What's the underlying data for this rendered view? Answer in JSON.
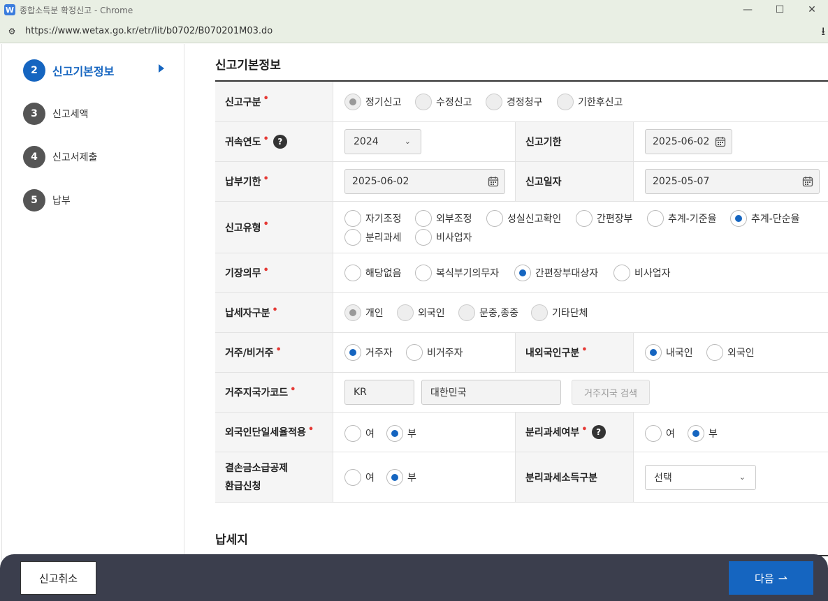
{
  "browser": {
    "app_icon_letter": "W",
    "window_title": "종합소득분 확정신고 - Chrome",
    "url": "https://www.wetax.go.kr/etr/lit/b0702/B070201M03.do"
  },
  "sidebar": {
    "steps": [
      {
        "num": "2",
        "label": "신고기본정보"
      },
      {
        "num": "3",
        "label": "신고세액"
      },
      {
        "num": "4",
        "label": "신고서제출"
      },
      {
        "num": "5",
        "label": "납부"
      }
    ]
  },
  "main": {
    "section_title": "신고기본정보",
    "section2_title": "납세지",
    "required_mark": "•",
    "help_mark": "?",
    "report_type": {
      "label": "신고구분",
      "options": [
        "정기신고",
        "수정신고",
        "경정청구",
        "기한후신고"
      ]
    },
    "tax_year": {
      "label": "귀속연도",
      "value": "2024"
    },
    "report_deadline": {
      "label": "신고기한",
      "value": "2025-06-02"
    },
    "payment_deadline": {
      "label": "납부기한",
      "value": "2025-06-02"
    },
    "report_date": {
      "label": "신고일자",
      "value": "2025-05-07"
    },
    "report_kind": {
      "label": "신고유형",
      "options": [
        "자기조정",
        "외부조정",
        "성실신고확인",
        "간편장부",
        "추계-기준율",
        "추계-단순율",
        "분리과세",
        "비사업자"
      ]
    },
    "bookkeeping": {
      "label": "기장의무",
      "options": [
        "해당없음",
        "복식부기의무자",
        "간편장부대상자",
        "비사업자"
      ]
    },
    "taxpayer_type": {
      "label": "납세자구분",
      "options": [
        "개인",
        "외국인",
        "문중,종중",
        "기타단체"
      ]
    },
    "residency": {
      "label": "거주/비거주",
      "options": [
        "거주자",
        "비거주자"
      ]
    },
    "nationality": {
      "label": "내외국인구분",
      "options": [
        "내국인",
        "외국인"
      ]
    },
    "country_code": {
      "label": "거주지국가코드",
      "code": "KR",
      "name": "대한민국",
      "search_button": "거주지국 검색"
    },
    "foreigner_flat_rate": {
      "label": "외국인단일세율적용",
      "options": [
        "여",
        "부"
      ]
    },
    "separate_tax": {
      "label": "분리과세여부",
      "options": [
        "여",
        "부"
      ]
    },
    "loss_carryback": {
      "label_line1": "결손금소급공제",
      "label_line2": "환급신청",
      "options": [
        "여",
        "부"
      ]
    },
    "separate_income": {
      "label": "분리과세소득구분",
      "value": "선택"
    }
  },
  "footer": {
    "cancel_label": "신고취소",
    "next_label": "다음",
    "next_arrow": "⇀"
  },
  "colors": {
    "accent": "#1565c0",
    "footer_bg": "#3b3e4d",
    "required": "#e53935"
  }
}
